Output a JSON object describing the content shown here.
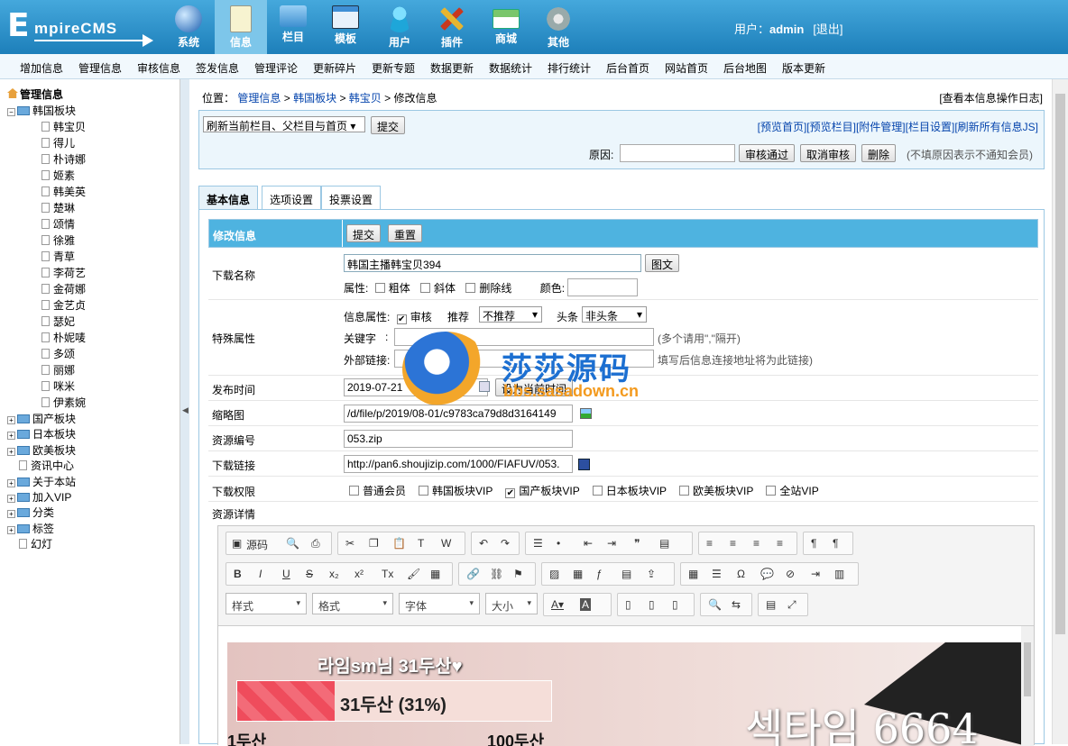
{
  "brand": {
    "logo_big": "E",
    "logo_small": "mpireCMS"
  },
  "topnav": [
    {
      "label": "系统",
      "icon": "globe-icon"
    },
    {
      "label": "信息",
      "icon": "notepad-icon"
    },
    {
      "label": "栏目",
      "icon": "folder-icon"
    },
    {
      "label": "模板",
      "icon": "window-icon"
    },
    {
      "label": "用户",
      "icon": "user-icon"
    },
    {
      "label": "插件",
      "icon": "tools-icon"
    },
    {
      "label": "商城",
      "icon": "card-icon"
    },
    {
      "label": "其他",
      "icon": "gear-icon"
    }
  ],
  "user": {
    "prefix": "用户：",
    "name": "admin",
    "logout": "[退出]"
  },
  "menubar": [
    "增加信息",
    "管理信息",
    "审核信息",
    "签发信息",
    "管理评论",
    "更新碎片",
    "更新专题",
    "数据更新",
    "数据统计",
    "排行统计",
    "后台首页",
    "网站首页",
    "后台地图",
    "版本更新"
  ],
  "tree": {
    "root": "管理信息",
    "group": "韩国板块",
    "children": [
      "韩宝贝",
      "得儿",
      "朴诗娜",
      "姬素",
      "韩美英",
      "楚琳",
      "颂情",
      "徐雅",
      "青草",
      "李荷艺",
      "金荷娜",
      "金艺贞",
      "瑟妃",
      "朴妮唛",
      "多颂",
      "丽娜",
      "咪米",
      "伊素婉"
    ],
    "others": [
      "国产板块",
      "日本板块",
      "欧美板块",
      "资讯中心",
      "关于本站",
      "加入VIP",
      "分类",
      "标签",
      "幻灯"
    ]
  },
  "breadcrumb": {
    "label": "位置：",
    "items": [
      "管理信息",
      "韩国板块",
      "韩宝贝"
    ],
    "current": "修改信息",
    "sep": ">"
  },
  "oplog": "[查看本信息操作日志]",
  "panel": {
    "refresh_select": "刷新当前栏目、父栏目与首页",
    "submit": "提交",
    "links": [
      "[预览首页]",
      "[预览栏目]",
      "[附件管理]",
      "[栏目设置]",
      "[刷新所有信息JS]"
    ],
    "reason_label": "原因:",
    "approve": "审核通过",
    "cancel_approve": "取消审核",
    "delete": "删除",
    "reason_note": "(不填原因表示不通知会员)"
  },
  "tabs": [
    "基本信息",
    "选项设置",
    "投票设置"
  ],
  "form": {
    "header": "修改信息",
    "submit": "提交",
    "reset": "重置",
    "title_label": "下载名称",
    "title_value": "韩国主播韩宝贝394",
    "title_btn": "图文",
    "attr_label": "属性:",
    "bold": "粗体",
    "italic": "斜体",
    "strike": "删除线",
    "color_label": "颜色:",
    "special_label": "特殊属性",
    "info_attr": "信息属性:",
    "audit": "审核",
    "recommend_label": "推荐",
    "recommend_value": "不推荐",
    "headline_label": "头条",
    "headline_value": "非头条",
    "keywords_label": "关键字",
    "keywords_note": "(多个请用\",\"隔开)",
    "extlink_label": "外部链接:",
    "extlink_note": "填写后信息连接地址将为此链接)",
    "date_label": "发布时间",
    "date_value": "2019-07-21",
    "date_btn": "设为当前时间",
    "thumb_label": "缩略图",
    "thumb_value": "/d/file/p/2019/08-01/c9783ca79d8d3164149",
    "resid_label": "资源编号",
    "resid_value": "053.zip",
    "dl_label": "下载链接",
    "dl_value": "http://pan6.shoujizip.com/1000/FIAFUV/053.",
    "perm_label": "下载权限",
    "perms": [
      {
        "label": "普通会员",
        "checked": false
      },
      {
        "label": "韩国板块VIP",
        "checked": false
      },
      {
        "label": "国产板块VIP",
        "checked": true
      },
      {
        "label": "日本板块VIP",
        "checked": false
      },
      {
        "label": "欧美板块VIP",
        "checked": false
      },
      {
        "label": "全站VIP",
        "checked": false
      }
    ],
    "detail_label": "资源详情"
  },
  "editor": {
    "source": "源码",
    "style": "样式",
    "format": "格式",
    "font": "字体",
    "size": "大小",
    "content": {
      "t1": "라임sm님 31두산♥",
      "bar": "31두산 (31%)",
      "progress": 0.31,
      "left": "1두산",
      "right": "100두산",
      "sign": "섹타임 6664"
    }
  },
  "watermark": {
    "cn": "莎莎源码",
    "url": "bbs.sasadown.cn"
  }
}
